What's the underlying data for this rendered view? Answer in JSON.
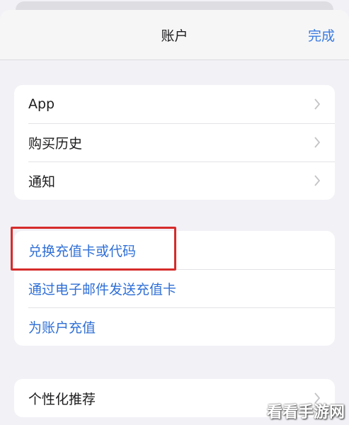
{
  "header": {
    "title": "账户",
    "done_label": "完成"
  },
  "group1": {
    "items": [
      {
        "label": "App"
      },
      {
        "label": "购买历史"
      },
      {
        "label": "通知"
      }
    ]
  },
  "group2": {
    "items": [
      {
        "label": "兑换充值卡或代码"
      },
      {
        "label": "通过电子邮件发送充值卡"
      },
      {
        "label": "为账户充值"
      }
    ]
  },
  "group3": {
    "items": [
      {
        "label": "个性化推荐"
      }
    ]
  },
  "watermark": "看看手游网",
  "colors": {
    "accent": "#3a7be0",
    "highlight": "#d62b2b",
    "background": "#f2f1f6"
  }
}
